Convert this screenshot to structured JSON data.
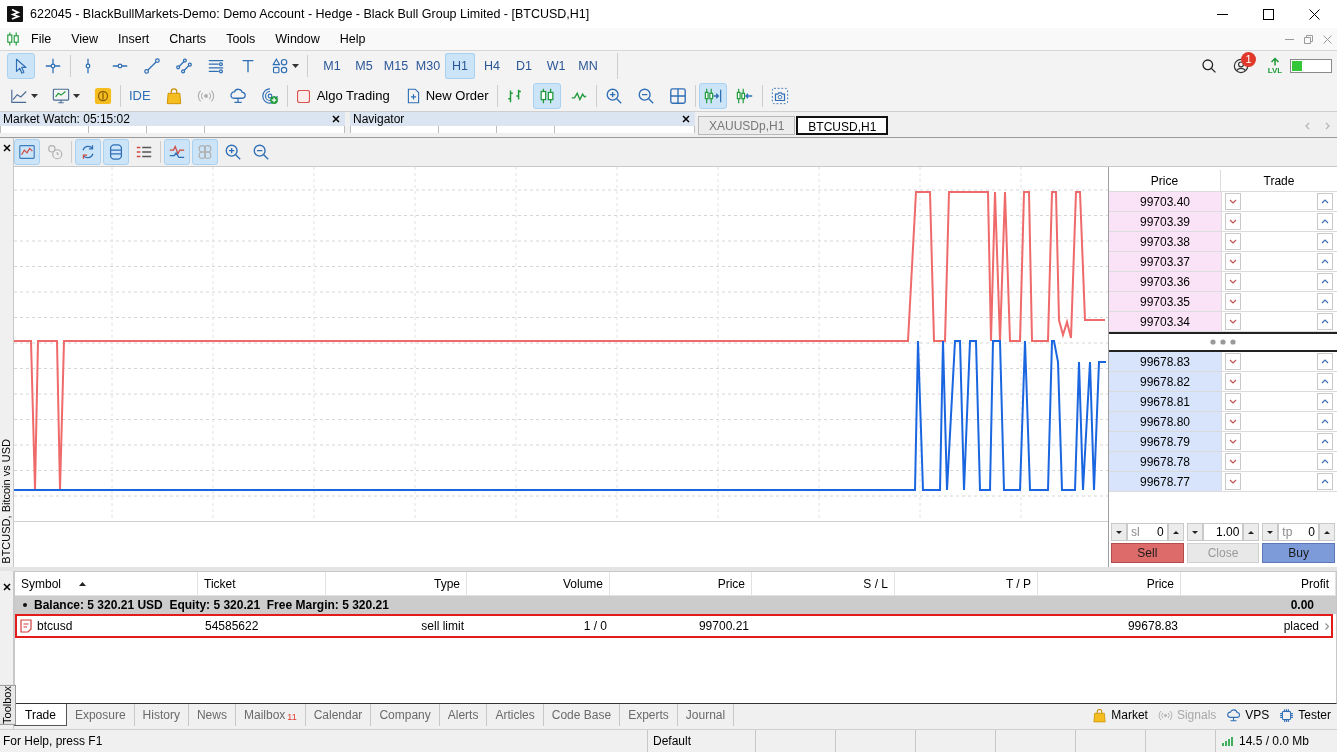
{
  "window": {
    "title": "622045 - BlackBullMarkets-Demo: Demo Account - Hedge - Black Bull Group Limited - [BTCUSD,H1]"
  },
  "menu": [
    "File",
    "View",
    "Insert",
    "Charts",
    "Tools",
    "Window",
    "Help"
  ],
  "toolbar": {
    "tool_groups": [
      [
        {
          "kind": "cursor",
          "selected": true
        },
        {
          "kind": "crosshair",
          "selected": false
        }
      ],
      [
        {
          "kind": "vertical-line",
          "selected": false
        },
        {
          "kind": "horizontal-line",
          "selected": false
        },
        {
          "kind": "trend-line",
          "selected": false
        },
        {
          "kind": "channel",
          "selected": false
        },
        {
          "kind": "fibonacci",
          "selected": false
        },
        {
          "kind": "text",
          "selected": false
        },
        {
          "kind": "shapes",
          "selected": false
        }
      ]
    ],
    "timeframes": [
      {
        "label": "M1",
        "selected": false
      },
      {
        "label": "M5",
        "selected": false
      },
      {
        "label": "M15",
        "selected": false
      },
      {
        "label": "M30",
        "selected": false
      },
      {
        "label": "H1",
        "selected": true
      },
      {
        "label": "H4",
        "selected": false
      },
      {
        "label": "D1",
        "selected": false
      },
      {
        "label": "W1",
        "selected": false
      },
      {
        "label": "MN",
        "selected": false
      }
    ],
    "notifications": "1",
    "level_label": "LVL",
    "level": 0.25
  },
  "toolbar_2": {
    "groups": [
      [
        {
          "kind": "chart-type",
          "selected": false
        },
        {
          "kind": "templates",
          "selected": false
        },
        {
          "kind": "coin",
          "selected": false
        }
      ],
      [
        {
          "kind": "ide",
          "label": "IDE",
          "selected": false
        },
        {
          "kind": "bag",
          "selected": false
        },
        {
          "kind": "signals",
          "selected": false
        },
        {
          "kind": "vps",
          "selected": false
        },
        {
          "kind": "radar",
          "selected": false
        }
      ],
      [
        {
          "kind": "algo-trading",
          "label": "Algo Trading",
          "on": false,
          "selected": false
        },
        {
          "kind": "new-order",
          "label": "New Order",
          "selected": false
        }
      ],
      [
        {
          "kind": "bar-chart",
          "selected": false
        },
        {
          "kind": "candles",
          "selected": true
        },
        {
          "kind": "line",
          "selected": false
        }
      ],
      [
        {
          "kind": "zoom-in",
          "selected": false
        },
        {
          "kind": "zoom-out",
          "selected": false
        },
        {
          "kind": "tile",
          "selected": false
        }
      ],
      [
        {
          "kind": "autoscroll",
          "selected": true
        },
        {
          "kind": "chart-shift",
          "selected": false
        }
      ],
      [
        {
          "kind": "screenshot",
          "selected": false
        }
      ]
    ]
  },
  "docked_panels": [
    {
      "title": "Market Watch: 05:15:02"
    },
    {
      "title": "Navigator"
    }
  ],
  "chart_tabs": [
    {
      "label": "XAUUSDp,H1",
      "selected": false
    },
    {
      "label": "BTCUSD,H1",
      "selected": true
    }
  ],
  "chart_window": {
    "toolbar_groups": [
      [
        {
          "kind": "chart-window",
          "selected": true
        },
        {
          "kind": "clocks",
          "selected": false
        }
      ],
      [
        {
          "kind": "sync-scroll",
          "selected": true
        },
        {
          "kind": "depth",
          "selected": true
        },
        {
          "kind": "trade-list",
          "selected": false
        }
      ],
      [
        {
          "kind": "ticks",
          "selected": true
        },
        {
          "kind": "volumes",
          "selected": true
        },
        {
          "kind": "zoom-in",
          "selected": false
        },
        {
          "kind": "zoom-out",
          "selected": false
        }
      ]
    ],
    "symbol_label": "BTCUSD, Bitcoin vs USD"
  },
  "depth_of_market": {
    "columns": [
      "Price",
      "Trade"
    ],
    "asks": [
      "99703.40",
      "99703.39",
      "99703.38",
      "99703.37",
      "99703.36",
      "99703.35",
      "99703.34"
    ],
    "bids": [
      "99678.83",
      "99678.82",
      "99678.81",
      "99678.80",
      "99678.79",
      "99678.78",
      "99678.77"
    ],
    "stop_loss": {
      "label": "sl",
      "value": "0"
    },
    "volume": "1.00",
    "take_profit": {
      "label": "tp",
      "value": "0"
    },
    "buttons": [
      {
        "kind": "sell",
        "label": "Sell",
        "disabled": false
      },
      {
        "kind": "close",
        "label": "Close",
        "disabled": true
      },
      {
        "kind": "buy",
        "label": "Buy",
        "disabled": false
      }
    ]
  },
  "toolbox": {
    "label": "Toolbox",
    "columns": [
      {
        "label": "Symbol",
        "sorted": true
      },
      {
        "label": "Ticket",
        "sorted": false
      },
      {
        "label": "Type",
        "sorted": false
      },
      {
        "label": "Volume",
        "sorted": false
      },
      {
        "label": "Price",
        "sorted": false
      },
      {
        "label": "S / L",
        "sorted": false
      },
      {
        "label": "T / P",
        "sorted": false
      },
      {
        "label": "Price",
        "sorted": false
      },
      {
        "label": "Profit",
        "sorted": false
      }
    ],
    "summary": {
      "text": "Balance: 5 320.21 USD  Equity: 5 320.21  Free Margin: 5 320.21",
      "profit": "0.00"
    },
    "orders": [
      {
        "symbol": "btcusd",
        "ticket": "54585622",
        "type": "sell limit",
        "volume": "1 / 0",
        "price": "99700.21",
        "current_price": "99678.83",
        "profit": "placed",
        "highlighted": true
      }
    ],
    "tabs": [
      {
        "label": "Trade",
        "selected": true
      },
      {
        "label": "Exposure",
        "selected": false
      },
      {
        "label": "History",
        "selected": false
      },
      {
        "label": "News",
        "selected": false
      },
      {
        "label": "Mailbox",
        "badge": "11",
        "selected": false
      },
      {
        "label": "Calendar",
        "selected": false
      },
      {
        "label": "Company",
        "selected": false
      },
      {
        "label": "Alerts",
        "selected": false
      },
      {
        "label": "Articles",
        "selected": false
      },
      {
        "label": "Code Base",
        "selected": false
      },
      {
        "label": "Experts",
        "selected": false
      },
      {
        "label": "Journal",
        "selected": false
      }
    ],
    "links": [
      {
        "kind": "market",
        "label": "Market",
        "disabled": false
      },
      {
        "kind": "signals",
        "label": "Signals",
        "disabled": true
      },
      {
        "kind": "vps",
        "label": "VPS",
        "disabled": false
      },
      {
        "kind": "tester",
        "label": "Tester",
        "disabled": false
      }
    ]
  },
  "status_bar": {
    "help": "For Help, press F1",
    "profile": "Default",
    "memory": "14.5 / 0.0 Mb"
  }
}
